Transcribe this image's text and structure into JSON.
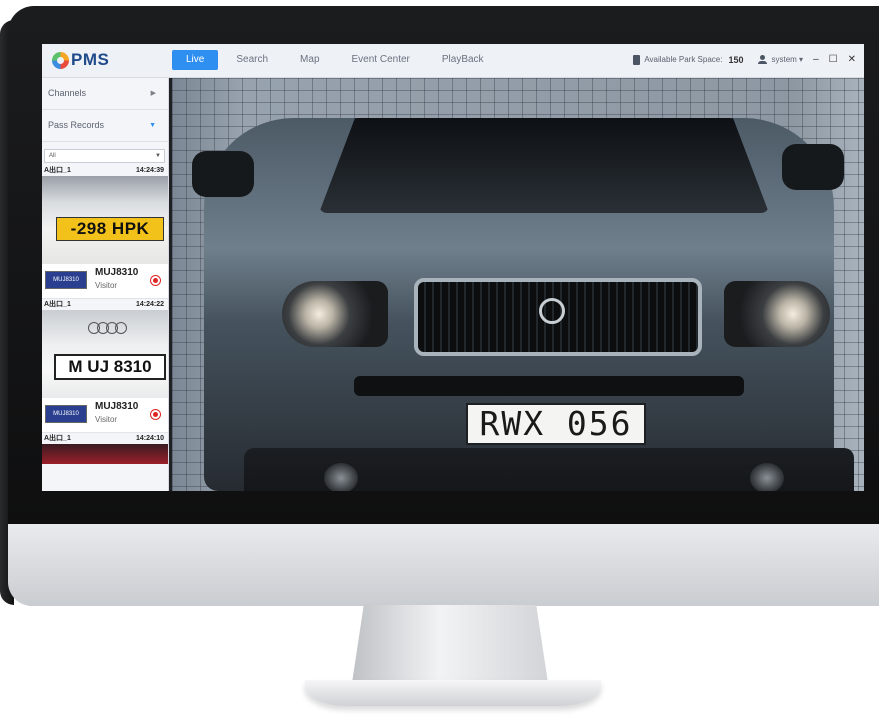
{
  "app": {
    "logo_text": "PMS"
  },
  "nav": {
    "tabs": [
      {
        "label": "Live",
        "active": true
      },
      {
        "label": "Search",
        "active": false
      },
      {
        "label": "Map",
        "active": false
      },
      {
        "label": "Event Center",
        "active": false
      },
      {
        "label": "PlayBack",
        "active": false
      }
    ]
  },
  "status": {
    "park_label": "Available Park Space:",
    "park_value": "150",
    "user": "system ▾",
    "minimize": "–",
    "maximize": "☐",
    "close": "✕"
  },
  "sidebar": {
    "channels_label": "Channels",
    "pass_records_label": "Pass Records",
    "filter_value": "All",
    "records": [
      {
        "location": "A出口_1",
        "time": "14:24:39",
        "plate_text": "-298 HPK",
        "plate": "MUJ8310",
        "type": "Visitor"
      },
      {
        "location": "A出口_1",
        "time": "14:24:22",
        "plate_text": "M UJ 8310",
        "plate": "MUJ8310",
        "type": "Visitor"
      },
      {
        "location": "A出口_1",
        "time": "14:24:10"
      }
    ]
  },
  "video": {
    "plate_text": "RWX 056"
  },
  "colors": {
    "accent": "#2e8ff0",
    "alert": "#e02424"
  }
}
